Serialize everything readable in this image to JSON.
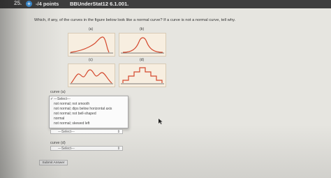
{
  "header": {
    "question_number": "25.",
    "points": "-/4 points",
    "code": "BBUnderStat12 6.1.001."
  },
  "question_text": "Which, if any, of the curves in the figure below look like a normal curve? If a curve is not a normal curve, tell why.",
  "figure": {
    "panels": [
      {
        "label": "(a)"
      },
      {
        "label": "(b)"
      },
      {
        "label": "(c)"
      },
      {
        "label": "(d)"
      }
    ],
    "colors": {
      "panel_bg": "#f7eee0",
      "curve": "#d4472c",
      "axis": "#555555"
    }
  },
  "curve_a": {
    "label": "curve (a)",
    "dropdown": {
      "selected": "---Select---",
      "options": [
        "---Select---",
        "not normal; not smooth",
        "not normal; dips below horizontal axis",
        "not normal; not bell-shaped",
        "normal",
        "not normal; skewed left"
      ]
    }
  },
  "curve_c": {
    "select_value": "---Select---"
  },
  "curve_d": {
    "label": "curve (d)",
    "select_value": "---Select---"
  },
  "submit_label": "Submit Answer",
  "icons": {
    "plus": "+",
    "select_arrow": "⇕",
    "check": "✓"
  }
}
